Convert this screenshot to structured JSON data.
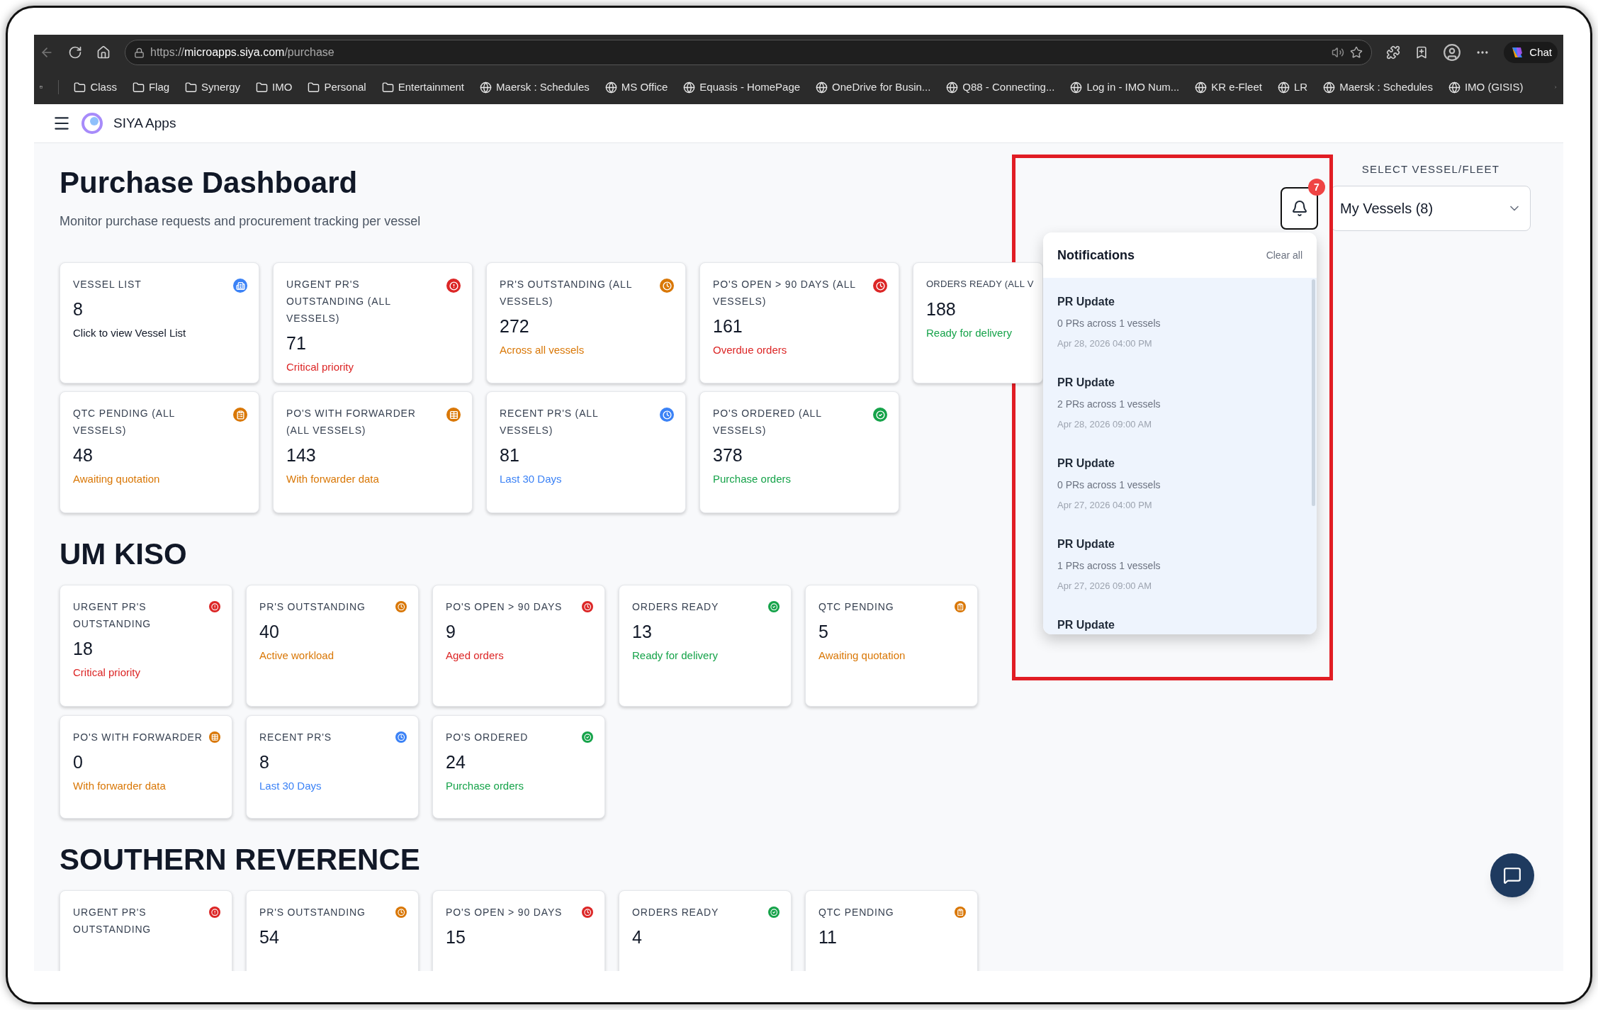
{
  "browser": {
    "url_scheme": "https://",
    "url_host": "microapps.siya.com",
    "url_path": "/purchase",
    "chat_label": "Chat",
    "bookmarks": [
      {
        "label": "Class",
        "kind": "folder"
      },
      {
        "label": "Flag",
        "kind": "folder"
      },
      {
        "label": "Synergy",
        "kind": "folder"
      },
      {
        "label": "IMO",
        "kind": "folder"
      },
      {
        "label": "Personal",
        "kind": "folder"
      },
      {
        "label": "Entertainment",
        "kind": "folder"
      },
      {
        "label": "Maersk : Schedules",
        "kind": "site"
      },
      {
        "label": "MS Office",
        "kind": "site"
      },
      {
        "label": "Equasis - HomePage",
        "kind": "site"
      },
      {
        "label": "OneDrive for Busin...",
        "kind": "site"
      },
      {
        "label": "Q88 - Connecting...",
        "kind": "site"
      },
      {
        "label": "Log in - IMO Num...",
        "kind": "site"
      },
      {
        "label": "KR e-Fleet",
        "kind": "site"
      },
      {
        "label": "LR",
        "kind": "site"
      },
      {
        "label": "Maersk : Schedules",
        "kind": "site"
      },
      {
        "label": "IMO (GISIS)",
        "kind": "site"
      }
    ]
  },
  "app_header": {
    "title": "SIYA Apps"
  },
  "page": {
    "title": "Purchase Dashboard",
    "subtitle": "Monitor purchase requests and procurement tracking per vessel"
  },
  "vessel_selector": {
    "label": "SELECT VESSEL/FLEET",
    "value": "My Vessels (8)"
  },
  "notifications": {
    "count": "7",
    "title": "Notifications",
    "clear": "Clear all",
    "items": [
      {
        "title": "PR Update",
        "detail": "0 PRs across 1 vessels",
        "time": "Apr 28, 2026 04:00 PM"
      },
      {
        "title": "PR Update",
        "detail": "2 PRs across 1 vessels",
        "time": "Apr 28, 2026 09:00 AM"
      },
      {
        "title": "PR Update",
        "detail": "0 PRs across 1 vessels",
        "time": "Apr 27, 2026 04:00 PM"
      },
      {
        "title": "PR Update",
        "detail": "1 PRs across 1 vessels",
        "time": "Apr 27, 2026 09:00 AM"
      },
      {
        "title": "PR Update"
      }
    ]
  },
  "overview_cards": [
    {
      "kind": "vessels",
      "label": "VESSEL LIST",
      "value": "8",
      "note": "Click to view Vessel List",
      "color": "#3b82f6"
    },
    {
      "kind": "urgent",
      "label": "URGENT PR'S OUTSTANDING (ALL VESSELS)",
      "value": "71",
      "note": "Critical priority",
      "color": "#dc2626"
    },
    {
      "kind": "pending",
      "label": "PR'S OUTSTANDING (ALL VESSELS)",
      "value": "272",
      "note": "Across all vessels",
      "color": "#d97706"
    },
    {
      "kind": "pending",
      "label": "PO'S OPEN > 90 DAYS (ALL VESSELS)",
      "value": "161",
      "note": "Overdue orders",
      "color": "#dc2626"
    },
    {
      "kind": "covered",
      "label": "ORDERS READY (ALL V",
      "value": "188",
      "note": "Ready for delivery",
      "color": "#16a34a"
    },
    {
      "kind": "quotation",
      "label": "QTC PENDING (ALL VESSELS)",
      "value": "48",
      "note": "Awaiting quotation",
      "color": "#d97706"
    },
    {
      "kind": "forwarder",
      "label": "PO'S WITH FORWARDER (ALL VESSELS)",
      "value": "143",
      "note": "With forwarder data",
      "color": "#d97706"
    },
    {
      "kind": "pending",
      "label": "RECENT PR'S (ALL VESSELS)",
      "value": "81",
      "note": "Last 30 Days",
      "color": "#3b82f6"
    },
    {
      "kind": "done",
      "label": "PO'S ORDERED (ALL VESSELS)",
      "value": "378",
      "note": "Purchase orders",
      "color": "#16a34a"
    }
  ],
  "sections": [
    {
      "title": "UM KISO",
      "cards": [
        {
          "kind": "urgent",
          "label": "URGENT PR'S OUTSTANDING",
          "value": "18",
          "note": "Critical priority",
          "color": "#dc2626"
        },
        {
          "kind": "pending",
          "label": "PR'S OUTSTANDING",
          "value": "40",
          "note": "Active workload",
          "color": "#d97706"
        },
        {
          "kind": "pending",
          "label": "PO'S OPEN > 90 DAYS",
          "value": "9",
          "note": "Aged orders",
          "color": "#dc2626"
        },
        {
          "kind": "done",
          "label": "ORDERS READY",
          "value": "13",
          "note": "Ready for delivery",
          "color": "#16a34a"
        },
        {
          "kind": "quotation",
          "label": "QTC PENDING",
          "value": "5",
          "note": "Awaiting quotation",
          "color": "#d97706"
        },
        {
          "kind": "forwarder",
          "label": "PO'S WITH FORWARDER",
          "value": "0",
          "note": "With forwarder data",
          "color": "#d97706"
        },
        {
          "kind": "pending",
          "label": "RECENT PR'S",
          "value": "8",
          "note": "Last 30 Days",
          "color": "#3b82f6"
        },
        {
          "kind": "done",
          "label": "PO'S ORDERED",
          "value": "24",
          "note": "Purchase orders",
          "color": "#16a34a"
        }
      ]
    },
    {
      "title": "SOUTHERN REVERENCE",
      "cards": [
        {
          "kind": "urgent",
          "label": "URGENT PR'S OUTSTANDING",
          "color": "#dc2626"
        },
        {
          "kind": "pending",
          "label": "PR'S OUTSTANDING",
          "value": "54",
          "color": "#d97706"
        },
        {
          "kind": "pending",
          "label": "PO'S OPEN > 90 DAYS",
          "value": "15",
          "color": "#dc2626"
        },
        {
          "kind": "done",
          "label": "ORDERS READY",
          "value": "4",
          "color": "#16a34a"
        },
        {
          "kind": "quotation",
          "label": "QTC PENDING",
          "value": "11",
          "color": "#d97706"
        }
      ]
    }
  ]
}
